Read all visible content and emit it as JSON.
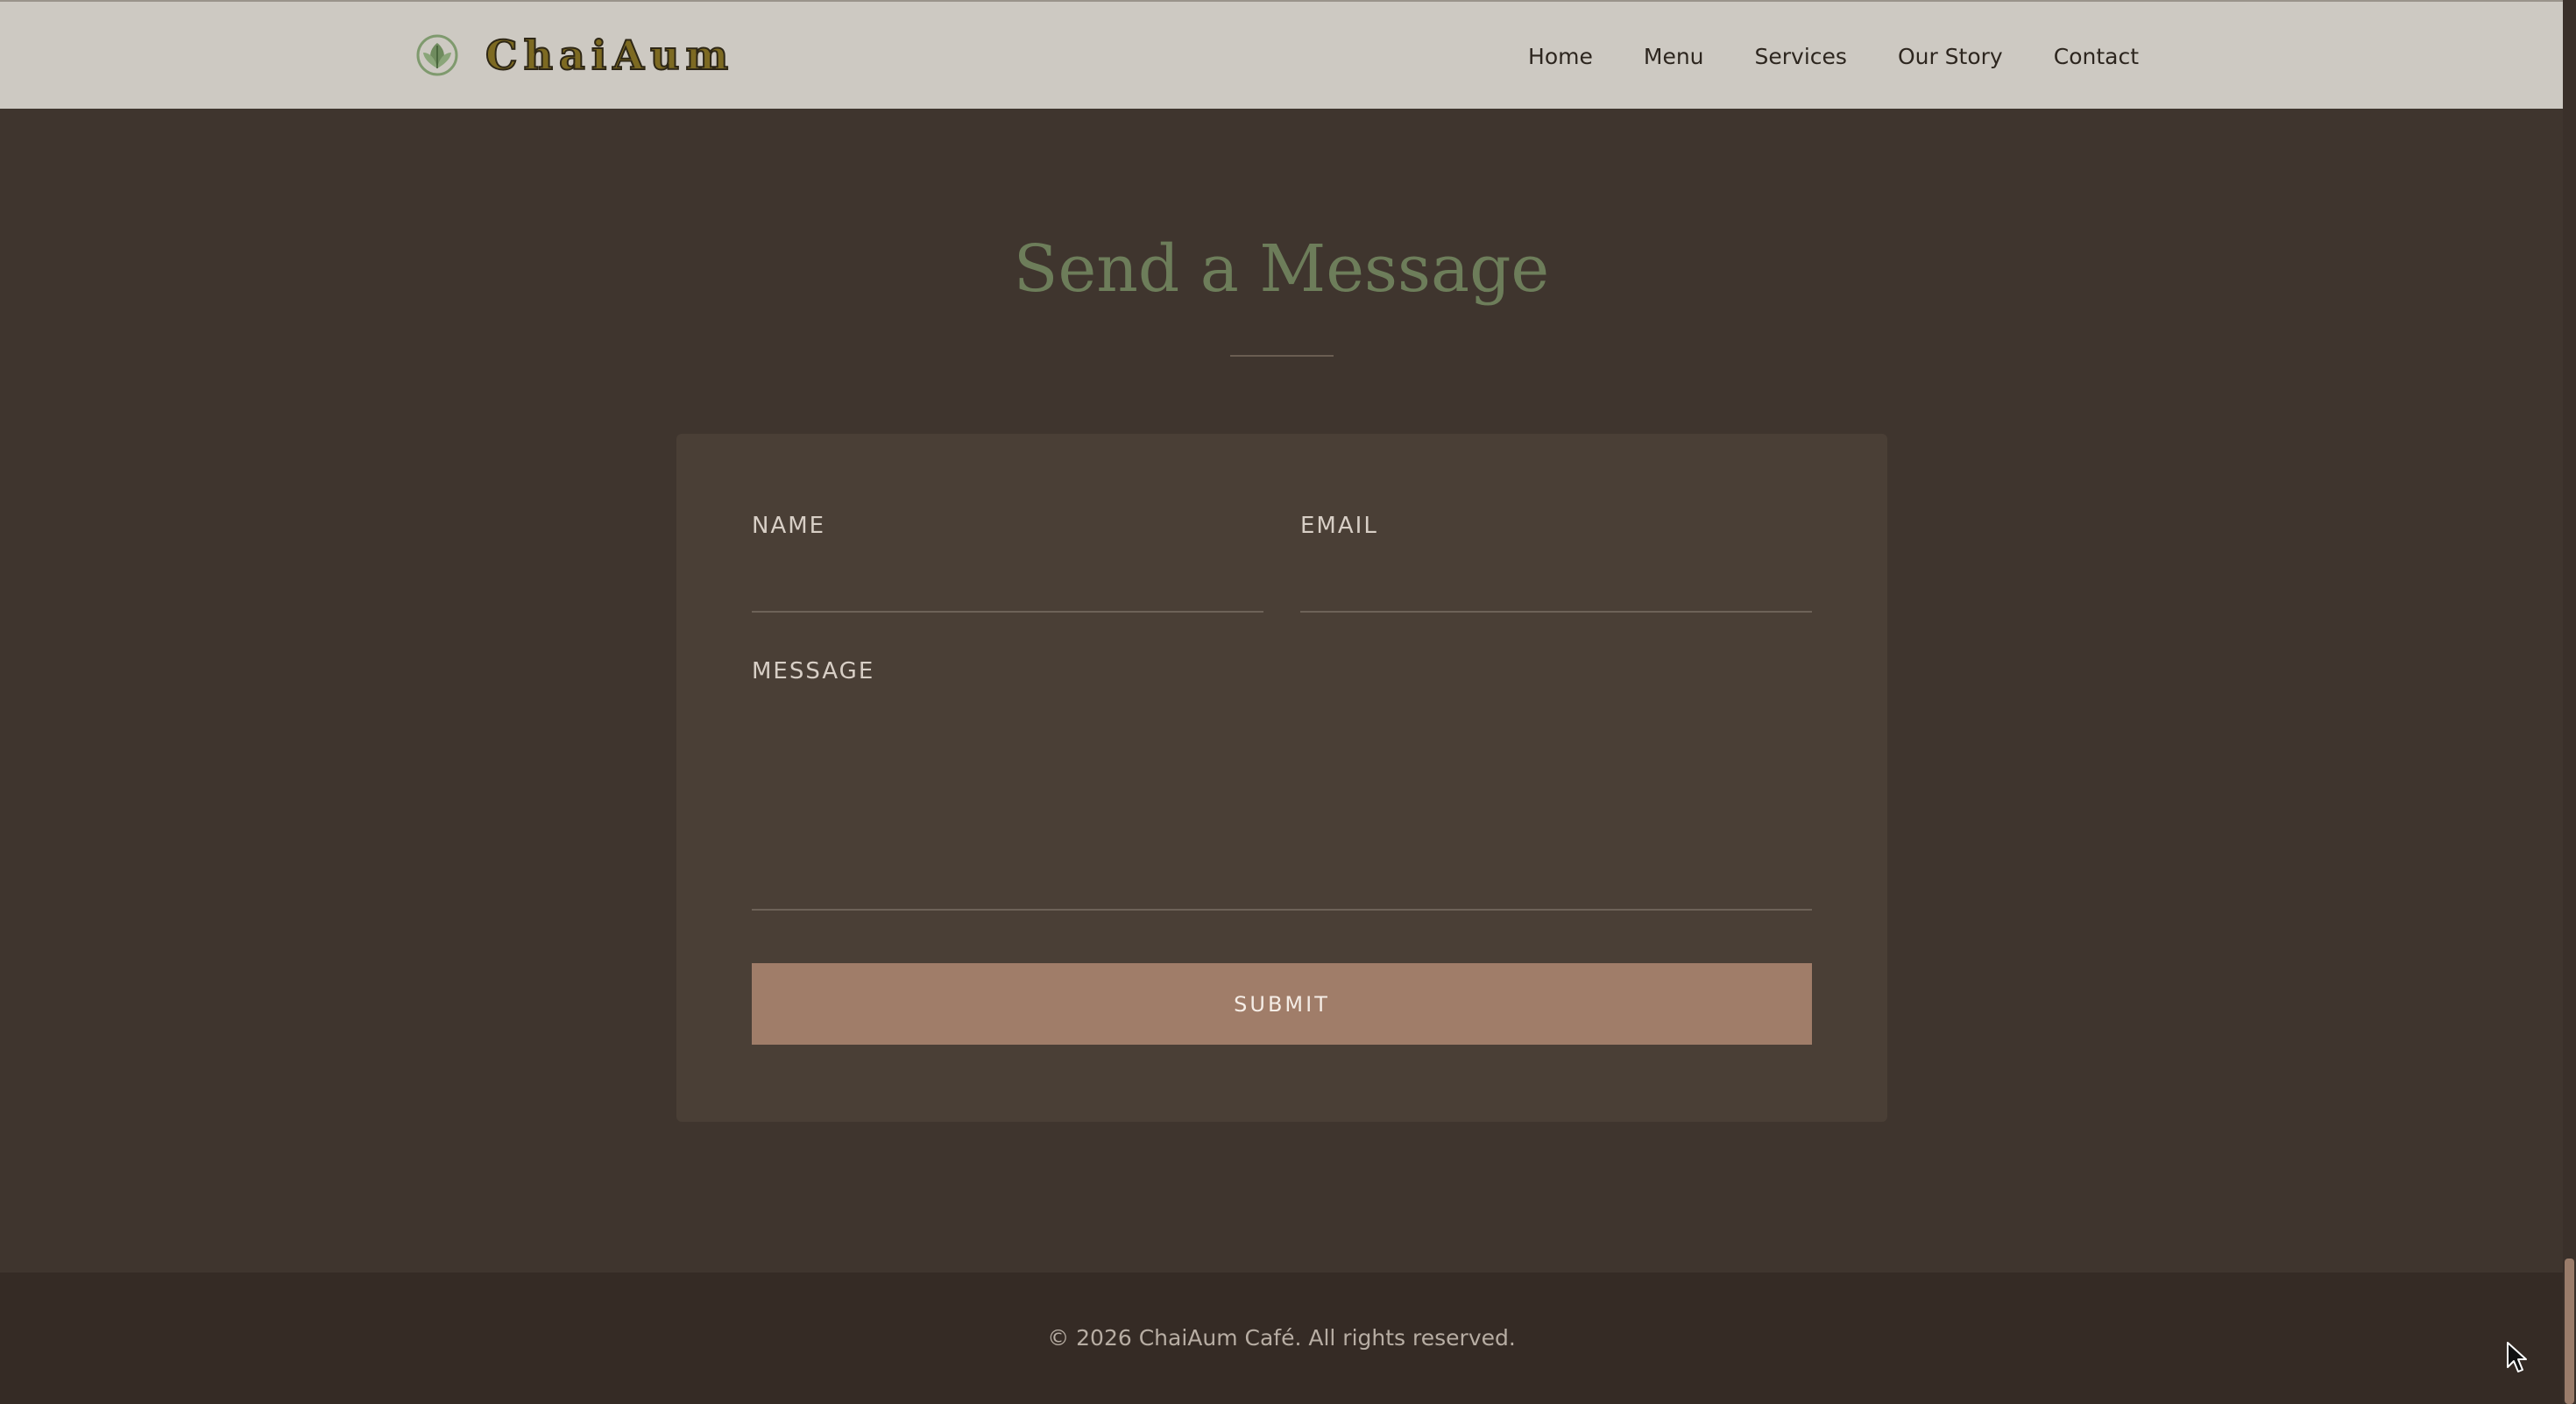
{
  "header": {
    "brand": "ChaiAum",
    "nav": [
      "Home",
      "Menu",
      "Services",
      "Our Story",
      "Contact"
    ]
  },
  "contact": {
    "title": "Send a Message",
    "name_label": "NAME",
    "email_label": "EMAIL",
    "message_label": "MESSAGE",
    "name_value": "",
    "email_value": "",
    "message_value": "",
    "submit_label": "SUBMIT"
  },
  "footer": {
    "copyright": "© 2026 ChaiAum Café. All rights reserved."
  },
  "icons": {
    "logo": "leaf-logo-icon",
    "cursor": "mouse-pointer-icon"
  },
  "colors": {
    "header_bg": "#cdc9c2",
    "page_bg": "#3f352e",
    "card_bg": "#4a3f36",
    "title": "#6d7d5a",
    "accent_button": "#a07d69",
    "footer_bg": "#352b25"
  }
}
